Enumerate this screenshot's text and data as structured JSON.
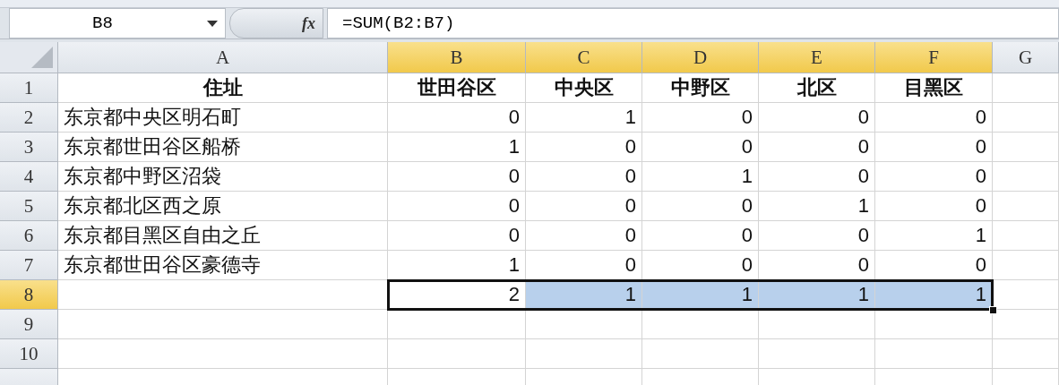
{
  "formula_bar": {
    "name_box": "B8",
    "function_label": "fx",
    "formula": "=SUM(B2:B7)"
  },
  "columns": [
    {
      "label": "A",
      "selected": false
    },
    {
      "label": "B",
      "selected": true
    },
    {
      "label": "C",
      "selected": true
    },
    {
      "label": "D",
      "selected": true
    },
    {
      "label": "E",
      "selected": true
    },
    {
      "label": "F",
      "selected": true
    },
    {
      "label": "G",
      "selected": false
    }
  ],
  "rows": [
    {
      "header": "1",
      "selected": false,
      "kind": "heading",
      "cells": [
        {
          "text": "住址",
          "selected": false,
          "active": false
        },
        {
          "text": "世田谷区",
          "selected": false,
          "active": false
        },
        {
          "text": "中央区",
          "selected": false,
          "active": false
        },
        {
          "text": "中野区",
          "selected": false,
          "active": false
        },
        {
          "text": "北区",
          "selected": false,
          "active": false
        },
        {
          "text": "目黑区",
          "selected": false,
          "active": false
        }
      ]
    },
    {
      "header": "2",
      "selected": false,
      "kind": "data",
      "cells": [
        {
          "text": "东京都中央区明石町",
          "selected": false,
          "active": false
        },
        {
          "text": "0",
          "selected": false,
          "active": false
        },
        {
          "text": "1",
          "selected": false,
          "active": false
        },
        {
          "text": "0",
          "selected": false,
          "active": false
        },
        {
          "text": "0",
          "selected": false,
          "active": false
        },
        {
          "text": "0",
          "selected": false,
          "active": false
        }
      ]
    },
    {
      "header": "3",
      "selected": false,
      "kind": "data",
      "cells": [
        {
          "text": "东京都世田谷区船桥",
          "selected": false,
          "active": false
        },
        {
          "text": "1",
          "selected": false,
          "active": false
        },
        {
          "text": "0",
          "selected": false,
          "active": false
        },
        {
          "text": "0",
          "selected": false,
          "active": false
        },
        {
          "text": "0",
          "selected": false,
          "active": false
        },
        {
          "text": "0",
          "selected": false,
          "active": false
        }
      ]
    },
    {
      "header": "4",
      "selected": false,
      "kind": "data",
      "cells": [
        {
          "text": "东京都中野区沼袋",
          "selected": false,
          "active": false
        },
        {
          "text": "0",
          "selected": false,
          "active": false
        },
        {
          "text": "0",
          "selected": false,
          "active": false
        },
        {
          "text": "1",
          "selected": false,
          "active": false
        },
        {
          "text": "0",
          "selected": false,
          "active": false
        },
        {
          "text": "0",
          "selected": false,
          "active": false
        }
      ]
    },
    {
      "header": "5",
      "selected": false,
      "kind": "data",
      "cells": [
        {
          "text": "东京都北区西之原",
          "selected": false,
          "active": false
        },
        {
          "text": "0",
          "selected": false,
          "active": false
        },
        {
          "text": "0",
          "selected": false,
          "active": false
        },
        {
          "text": "0",
          "selected": false,
          "active": false
        },
        {
          "text": "1",
          "selected": false,
          "active": false
        },
        {
          "text": "0",
          "selected": false,
          "active": false
        }
      ]
    },
    {
      "header": "6",
      "selected": false,
      "kind": "data",
      "cells": [
        {
          "text": "东京都目黑区自由之丘",
          "selected": false,
          "active": false
        },
        {
          "text": "0",
          "selected": false,
          "active": false
        },
        {
          "text": "0",
          "selected": false,
          "active": false
        },
        {
          "text": "0",
          "selected": false,
          "active": false
        },
        {
          "text": "0",
          "selected": false,
          "active": false
        },
        {
          "text": "1",
          "selected": false,
          "active": false
        }
      ]
    },
    {
      "header": "7",
      "selected": false,
      "kind": "data",
      "cells": [
        {
          "text": "东京都世田谷区豪德寺",
          "selected": false,
          "active": false
        },
        {
          "text": "1",
          "selected": false,
          "active": false
        },
        {
          "text": "0",
          "selected": false,
          "active": false
        },
        {
          "text": "0",
          "selected": false,
          "active": false
        },
        {
          "text": "0",
          "selected": false,
          "active": false
        },
        {
          "text": "0",
          "selected": false,
          "active": false
        }
      ]
    },
    {
      "header": "8",
      "selected": true,
      "kind": "data",
      "cells": [
        {
          "selected": false,
          "active": false
        },
        {
          "text": "2",
          "selected": true,
          "active": true
        },
        {
          "text": "1",
          "selected": true,
          "active": false
        },
        {
          "text": "1",
          "selected": true,
          "active": false
        },
        {
          "text": "1",
          "selected": true,
          "active": false
        },
        {
          "text": "1",
          "selected": true,
          "active": false
        }
      ]
    },
    {
      "header": "9",
      "selected": false,
      "kind": "data"
    },
    {
      "header": "10",
      "selected": false,
      "kind": "data"
    },
    {
      "selected": false,
      "kind": "data"
    }
  ]
}
